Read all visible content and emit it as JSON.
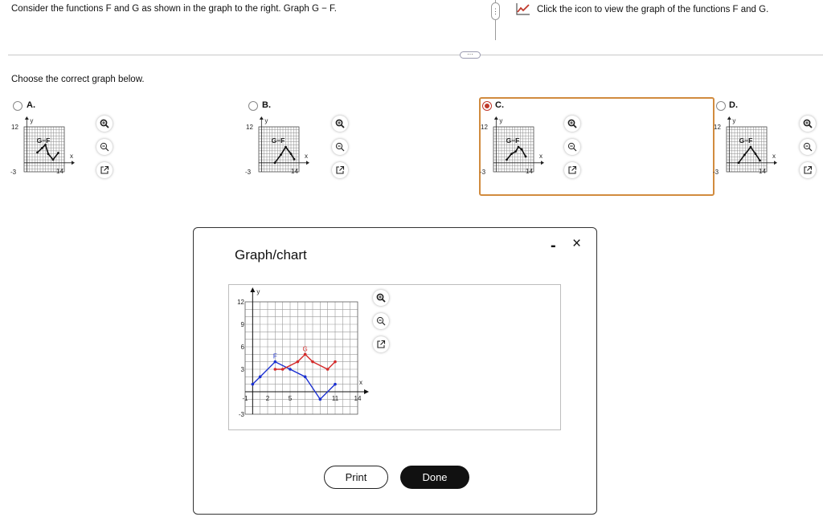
{
  "question": "Consider the functions F and G as shown in the graph to the right. Graph G − F.",
  "graph_link": {
    "text": "Click the icon to view the graph of the functions F and G.",
    "icon": "line-chart-icon"
  },
  "divider_handle_dots": "⋮",
  "panel_handle_label": "···",
  "prompt": "Choose the correct graph below.",
  "options": [
    {
      "letter": "A.",
      "selected": false,
      "curve_label": "G−F",
      "y_max": "12",
      "y_min": "-3",
      "x_max": "14",
      "x_axis": "x",
      "y_axis": "y"
    },
    {
      "letter": "B.",
      "selected": false,
      "curve_label": "G−F",
      "y_max": "12",
      "y_min": "-3",
      "x_max": "14",
      "x_axis": "x",
      "y_axis": "y"
    },
    {
      "letter": "C.",
      "selected": true,
      "curve_label": "G−F",
      "y_max": "12",
      "y_min": "-3",
      "x_max": "14",
      "x_axis": "x",
      "y_axis": "y"
    },
    {
      "letter": "D.",
      "selected": false,
      "curve_label": "G−F",
      "y_max": "12",
      "y_min": "-3",
      "x_max": "14",
      "x_axis": "x",
      "y_axis": "y"
    }
  ],
  "tools": [
    "zoom-in-icon",
    "zoom-out-icon",
    "open-external-icon"
  ],
  "colors": {
    "accent": "#c0392b",
    "selected_border": "#d18b3e",
    "f_series": "#1a2fd1",
    "g_series": "#d42a2a"
  },
  "modal": {
    "title": "Graph/chart",
    "minimize": "-",
    "close": "×",
    "print_label": "Print",
    "done_label": "Done"
  },
  "chart_data": {
    "type": "line",
    "xlabel": "x",
    "ylabel": "y",
    "xlim": [
      -1,
      14
    ],
    "ylim": [
      -3,
      12
    ],
    "x_ticks": [
      "-1",
      "2",
      "5",
      "11",
      "14"
    ],
    "y_ticks": [
      "12",
      "9",
      "6",
      "3",
      "-3"
    ],
    "series": [
      {
        "name": "F",
        "x": [
          0,
          1,
          3,
          5,
          7,
          9,
          11
        ],
        "y": [
          1,
          2,
          4,
          3,
          2,
          -1,
          1
        ]
      },
      {
        "name": "G",
        "x": [
          3,
          4,
          6,
          7,
          8,
          10,
          11
        ],
        "y": [
          3,
          3,
          4,
          5,
          4,
          3,
          4
        ]
      }
    ]
  }
}
